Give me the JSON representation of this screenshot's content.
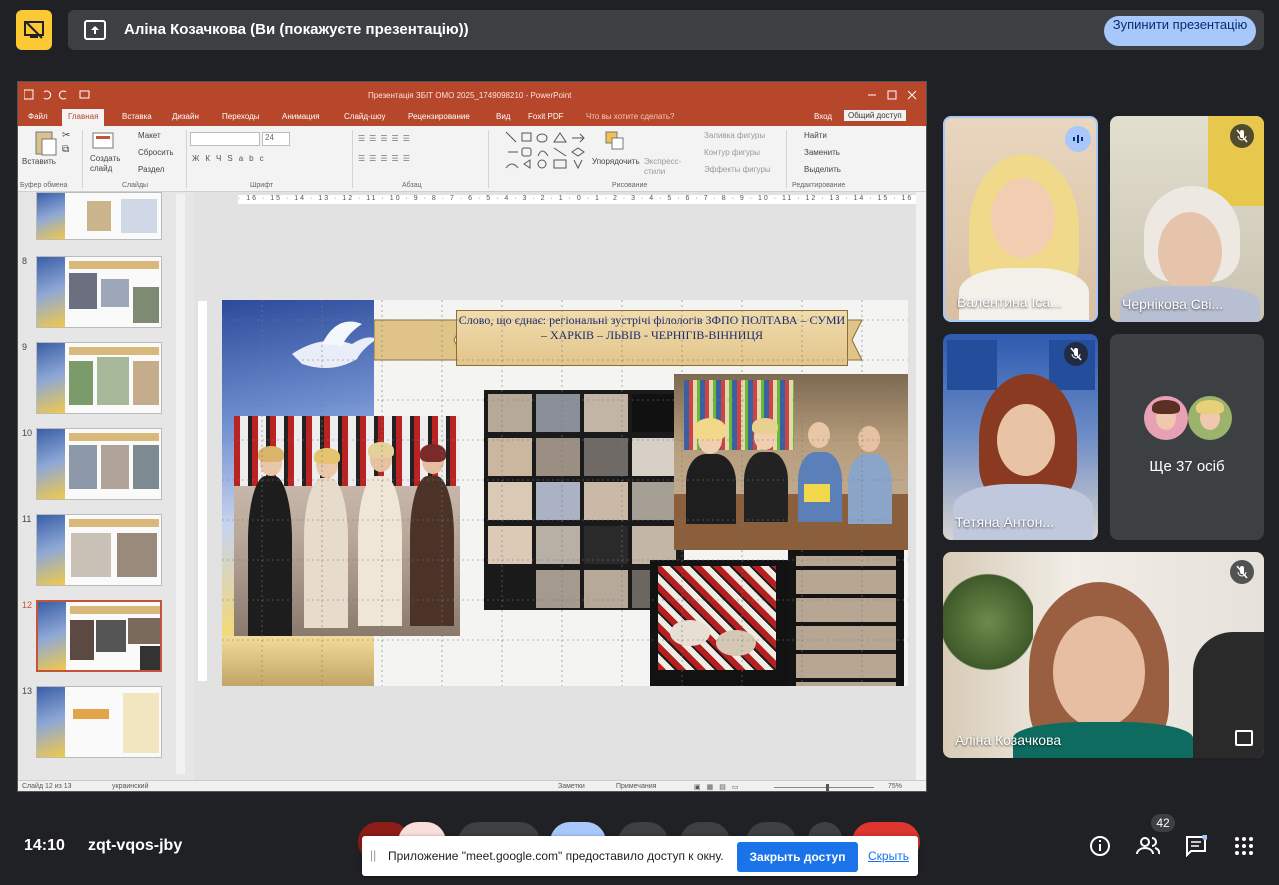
{
  "colors": {
    "background": "#202124",
    "accent": "#a8c7fa",
    "ppt_red": "#b7472a",
    "share_blue": "#1a73e8"
  },
  "banner": {
    "title": "Аліна Козачкова (Ви (покажуєте презентацію))",
    "stop_button": "Зупинити презентацію",
    "icons": [
      "presentation-off-icon",
      "present-to-all-icon"
    ]
  },
  "ppt": {
    "window_title": "Презентація ЗБIТ ОМО 2025_1749098210 - PowerPoint",
    "tabs": [
      "Файл",
      "Главная",
      "Вставка",
      "Дизайн",
      "Переходы",
      "Анимация",
      "Слайд-шоу",
      "Рецензирование",
      "Вид",
      "Foxit PDF",
      "Что вы хотите сделать?",
      "Вход",
      "Общий доступ"
    ],
    "active_tab": "Главная",
    "ribbon": {
      "paste": "Вставить",
      "new_slide": "Создать слайд",
      "layout": "Макет",
      "reset": "Сбросить",
      "section": "Раздел",
      "font_size": "24",
      "arrange": "Упорядочить",
      "quick_styles": "Экспресс-стили",
      "shape_fill": "Заливка фигуры",
      "shape_outline": "Контур фигуры",
      "shape_effects": "Эффекты фигуры",
      "find": "Найти",
      "replace": "Заменить",
      "select": "Выделить",
      "groups": [
        "Буфер обмена",
        "Слайды",
        "Шрифт",
        "Абзац",
        "Рисование",
        "Редактирование"
      ]
    },
    "thumbnails": [
      {
        "num": "8"
      },
      {
        "num": "9"
      },
      {
        "num": "10"
      },
      {
        "num": "11"
      },
      {
        "num": "12"
      },
      {
        "num": "13"
      }
    ],
    "selected_slide": "12",
    "ruler": "· 16 · 15 · 14 · 13 · 12 · 11 · 10 · 9 · 8 · 7 · 6 · 5 · 4 · 3 · 2 · 1 · 0 · 1 · 2 · 3 · 4 · 5 · 6 · 7 · 8 · 9 · 10 · 11 · 12 · 13 · 14 · 15 · 16 ·",
    "slide_title": "Слово, що єднає: регіональні зустрічі філологів ЗФПО ПОЛТАВА – СУМИ – ХАРКІВ – ЛЬВІВ - ЧЕРНІГІВ-ВІННИЦЯ",
    "status": {
      "slide_counter": "Слайд 12 из 13",
      "language": "украинский",
      "notes": "Заметки",
      "comments": "Примечания",
      "zoom": "75%"
    }
  },
  "participants": [
    {
      "name": "Валентина Іса...",
      "mic": "speaking"
    },
    {
      "name": "Чернікова Сві...",
      "mic": "muted"
    },
    {
      "name": "Тетяна Антон...",
      "mic": "muted"
    },
    {
      "name": "Ще 37 осіб",
      "mic": "none"
    },
    {
      "name": "Аліна Козачкова",
      "mic": "muted"
    }
  ],
  "bottom": {
    "time": "14:10",
    "meeting_code": "zqt-vqos-jby",
    "people_count": "42",
    "share_notice": "Приложение \"meet.google.com\" предоставило доступ к окну.",
    "share_stop": "Закрыть доступ",
    "share_hide": "Скрыть"
  }
}
